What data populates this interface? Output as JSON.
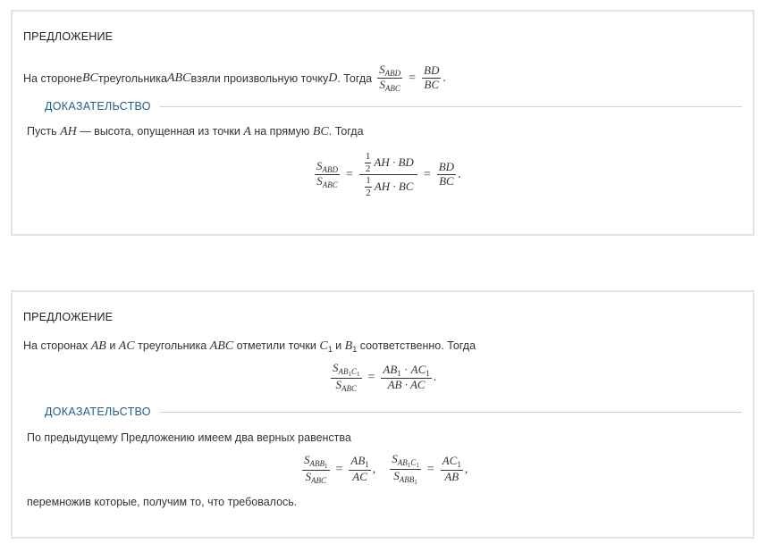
{
  "card1": {
    "heading": "ПРЕДЛОЖЕНИЕ",
    "statement": {
      "t1": "На стороне ",
      "m1": "BC",
      "t2": " треугольника ",
      "m2": "ABC",
      "t3": " взяли произвольную точку ",
      "m3": "D",
      "t4": ". Тогда",
      "frac_num_s": "S",
      "frac_num_sub": "ABD",
      "frac_den_s": "S",
      "frac_den_sub": "ABC",
      "eq": "=",
      "frac2_num": "BD",
      "frac2_den": "BC",
      "end": "."
    },
    "proof_title": "ДОКАЗАТЕЛЬСТВО",
    "proof": {
      "t1": "Пусть ",
      "m1": "AH",
      "t2": " —  высота, опущенная из точки ",
      "m2": "A",
      "t3": " на прямую ",
      "m3": "BC",
      "t4": ". Тогда"
    },
    "display": {
      "lhs_num_s": "S",
      "lhs_num_sub": "ABD",
      "lhs_den_s": "S",
      "lhs_den_sub": "ABC",
      "eq1": "=",
      "half_num": "1",
      "half_den": "2",
      "num_rest": "AH · BD",
      "den_rest": "AH · BC",
      "eq2": "=",
      "rhs_num": "BD",
      "rhs_den": "BC",
      "end": "."
    }
  },
  "card2": {
    "heading": "ПРЕДЛОЖЕНИЕ",
    "statement": {
      "t1": "На сторонах ",
      "m1": "AB",
      "t2": " и ",
      "m2": "AC",
      "t3": " треугольника ",
      "m3": "ABC",
      "t4": " отметили точки ",
      "m4": "C",
      "m4sub": "1",
      "t5": " и ",
      "m5": "B",
      "m5sub": "1",
      "t6": " соответственно. Тогда"
    },
    "display1": {
      "num_s": "S",
      "num_sub_a": "AB",
      "num_sub_b1": "1",
      "num_sub_c": "C",
      "num_sub_c1": "1",
      "den_s": "S",
      "den_sub": "ABC",
      "eq": "=",
      "rhs_num_a": "AB",
      "rhs_num_a1": "1",
      "rhs_num_dot": " · ",
      "rhs_num_b": "AC",
      "rhs_num_b1": "1",
      "rhs_den": "AB · AC",
      "end": "."
    },
    "proof_title": "ДОКАЗАТЕЛЬСТВО",
    "proof_text": "По предыдущему Предложению имеем два верных равенства",
    "display2": {
      "f1_num_s": "S",
      "f1_num_sub": "ABB",
      "f1_num_sub1": "1",
      "f1_den_s": "S",
      "f1_den_sub": "ABC",
      "eq1": "=",
      "f2_num": "AB",
      "f2_num1": "1",
      "f2_den": "AC",
      "comma1": ",",
      "f3_num_s": "S",
      "f3_num_sub_a": "AB",
      "f3_num_sub_b1": "1",
      "f3_num_sub_c": "C",
      "f3_num_sub_c1": "1",
      "f3_den_s": "S",
      "f3_den_sub": "ABB",
      "f3_den_sub1": "1",
      "eq2": "=",
      "f4_num": "AC",
      "f4_num1": "1",
      "f4_den": "AB",
      "comma2": ","
    },
    "conclusion": "перемножив которые, получим то, что требовалось."
  }
}
